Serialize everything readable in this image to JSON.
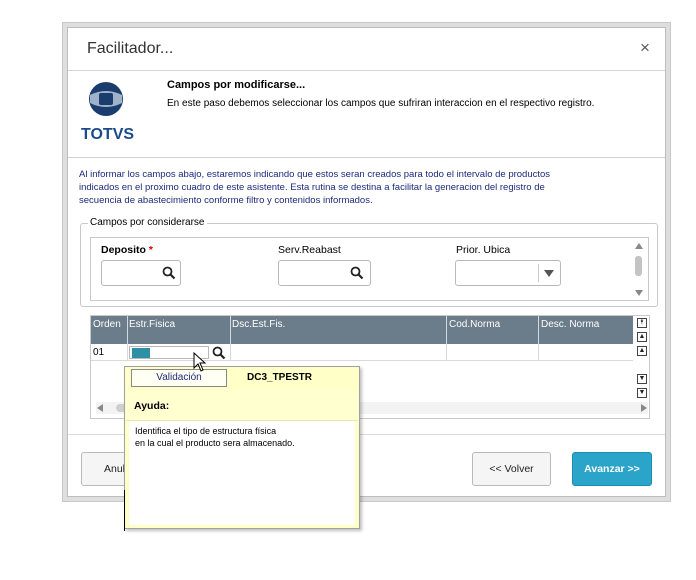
{
  "window": {
    "title": "Facilitador...",
    "close_glyph": "×"
  },
  "logo": {
    "text": "TOTVS",
    "color": "#1a4a8c"
  },
  "step": {
    "title": "Campos por modificarse...",
    "description": "En este paso debemos seleccionar los campos que sufriran interaccion en el respectivo registro."
  },
  "info": {
    "line1": "Al informar los campos abajo, estaremos indicando que estos seran creados para todo el intervalo de productos",
    "line2": "indicados en el proximo cuadro de este asistente. Esta rutina se destina a facilitar la generacion del registro de",
    "line3": "secuencia de abastecimiento conforme filtro y contenidos informados."
  },
  "group": {
    "legend": "Campos por considerarse",
    "fields": {
      "deposito": {
        "label": "Deposito",
        "required_mark": "*",
        "value": ""
      },
      "serv_reabast": {
        "label": "Serv.Reabast",
        "value": ""
      },
      "prior_ubica": {
        "label": "Prior. Ubica",
        "value": ""
      }
    }
  },
  "grid": {
    "columns": [
      "Orden",
      "Estr.Fisica",
      "Dsc.Est.Fis.",
      "Cod.Norma",
      "Desc. Norma"
    ],
    "rows": [
      {
        "orden": "01",
        "estr_fisica": "",
        "dsc_est_fis": "",
        "cod_norma": "",
        "desc_norma": ""
      }
    ],
    "header_color": "#6b7c8a",
    "edit_fill_color": "#2e8fa5"
  },
  "popup": {
    "validacion_label": "Validación",
    "field_code": "DC3_TPESTR",
    "ayuda_label": "Ayuda:",
    "help_text": "Identifica el tipo de estructura física\nen la cual el producto sera almacenado."
  },
  "footer": {
    "anular_label": "Anul",
    "volver_label": "<< Volver",
    "avanzar_label": "Avanzar >>",
    "primary_color": "#2aa4c9"
  },
  "icons": {
    "search": "search-icon",
    "chevron_down": "chevron-down-icon",
    "close": "close-icon"
  }
}
